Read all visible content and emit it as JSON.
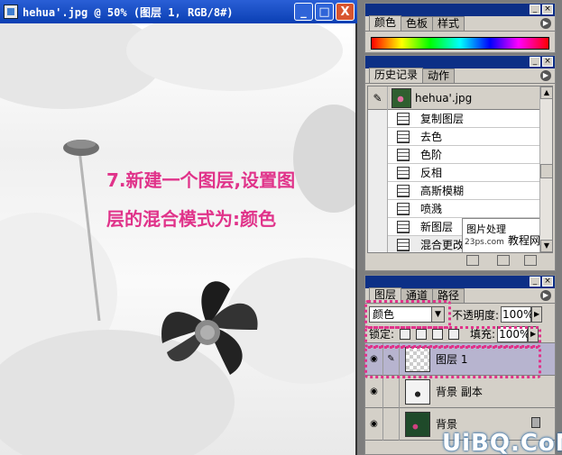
{
  "document": {
    "title": "hehua'.jpg @ 50% (图层 1, RGB/8#)",
    "minimize": "_",
    "maximize": "□",
    "close": "X"
  },
  "tutorial": {
    "line1": "7.新建一个图层,设置图",
    "line2": "层的混合模式为:颜色"
  },
  "color_panel": {
    "tabs": [
      "颜色",
      "色板",
      "样式"
    ]
  },
  "history_panel": {
    "tabs": [
      "历史记录",
      "动作"
    ],
    "snapshot": "hehua'.jpg",
    "items": [
      "复制图层",
      "去色",
      "色阶",
      "反相",
      "高斯模糊",
      "喷溅",
      "新图层",
      "混合更改"
    ],
    "watermark": {
      "line1": "图片处理",
      "line2": "23ps.com",
      "line3": "教程网"
    }
  },
  "layers_panel": {
    "tabs": [
      "图层",
      "通道",
      "路径"
    ],
    "blend_mode": "颜色",
    "opacity_label": "不透明度:",
    "opacity": "100%",
    "lock_label": "锁定:",
    "fill_label": "填充:",
    "fill": "100%",
    "layers": [
      {
        "name": "图层 1",
        "selected": true
      },
      {
        "name": "背景 副本",
        "selected": false
      },
      {
        "name": "背景",
        "selected": false
      }
    ]
  },
  "site_watermark": "UiBQ.CoM",
  "colors": {
    "highlight": "#e0338a",
    "titlebar": "#0a3fb3",
    "panel_bg": "#d4d0c8"
  }
}
